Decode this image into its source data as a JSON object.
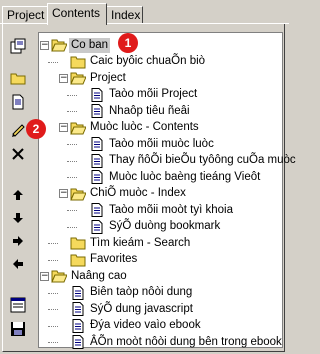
{
  "tabs": [
    {
      "label": "Project"
    },
    {
      "label": "Contents"
    },
    {
      "label": "Index"
    }
  ],
  "toolbar": {
    "buttons": [
      {
        "name": "properties-icon"
      },
      {
        "name": "new-folder-icon"
      },
      {
        "name": "new-page-icon"
      },
      {
        "name": "edit-pencil-icon"
      },
      {
        "name": "delete-icon"
      },
      {
        "name": "move-up-icon"
      },
      {
        "name": "move-down-icon"
      },
      {
        "name": "move-right-icon"
      },
      {
        "name": "move-left-icon"
      },
      {
        "name": "view-icon"
      },
      {
        "name": "save-icon"
      }
    ]
  },
  "tree": {
    "items": [
      {
        "label": "Co ban"
      },
      {
        "label": "Caic byôic chuaÕn biò"
      },
      {
        "label": "Project"
      },
      {
        "label": "Taòo mõii Project"
      },
      {
        "label": "Nhaôp tiêu ñeâi"
      },
      {
        "label": "Muòc luòc - Contents"
      },
      {
        "label": "Taòo mõii muòc luòc"
      },
      {
        "label": "Thay ñôÕi bieÕu tyôông cuÕa muòc"
      },
      {
        "label": "Muòc luòc baèng tieáng Vieôt"
      },
      {
        "label": "ChiÕ muòc - Index"
      },
      {
        "label": "Taòo mõii moòt tyì khoia"
      },
      {
        "label": "SýÕ duòng bookmark"
      },
      {
        "label": "Tìm kieám - Search"
      },
      {
        "label": "Favorites"
      },
      {
        "label": "Naâng cao"
      },
      {
        "label": "Biên taòp nôòi dung"
      },
      {
        "label": "SýÕ dung javascript"
      },
      {
        "label": "Ðýa video vaìo ebook"
      },
      {
        "label": "ÂÕn moòt nôòi dung bên trong ebook"
      }
    ]
  },
  "badges": {
    "one": "1",
    "two": "2"
  },
  "colors": {
    "badge": "#e01b1b",
    "selection": "#c9c9c9",
    "folder": "#f5d95c"
  }
}
